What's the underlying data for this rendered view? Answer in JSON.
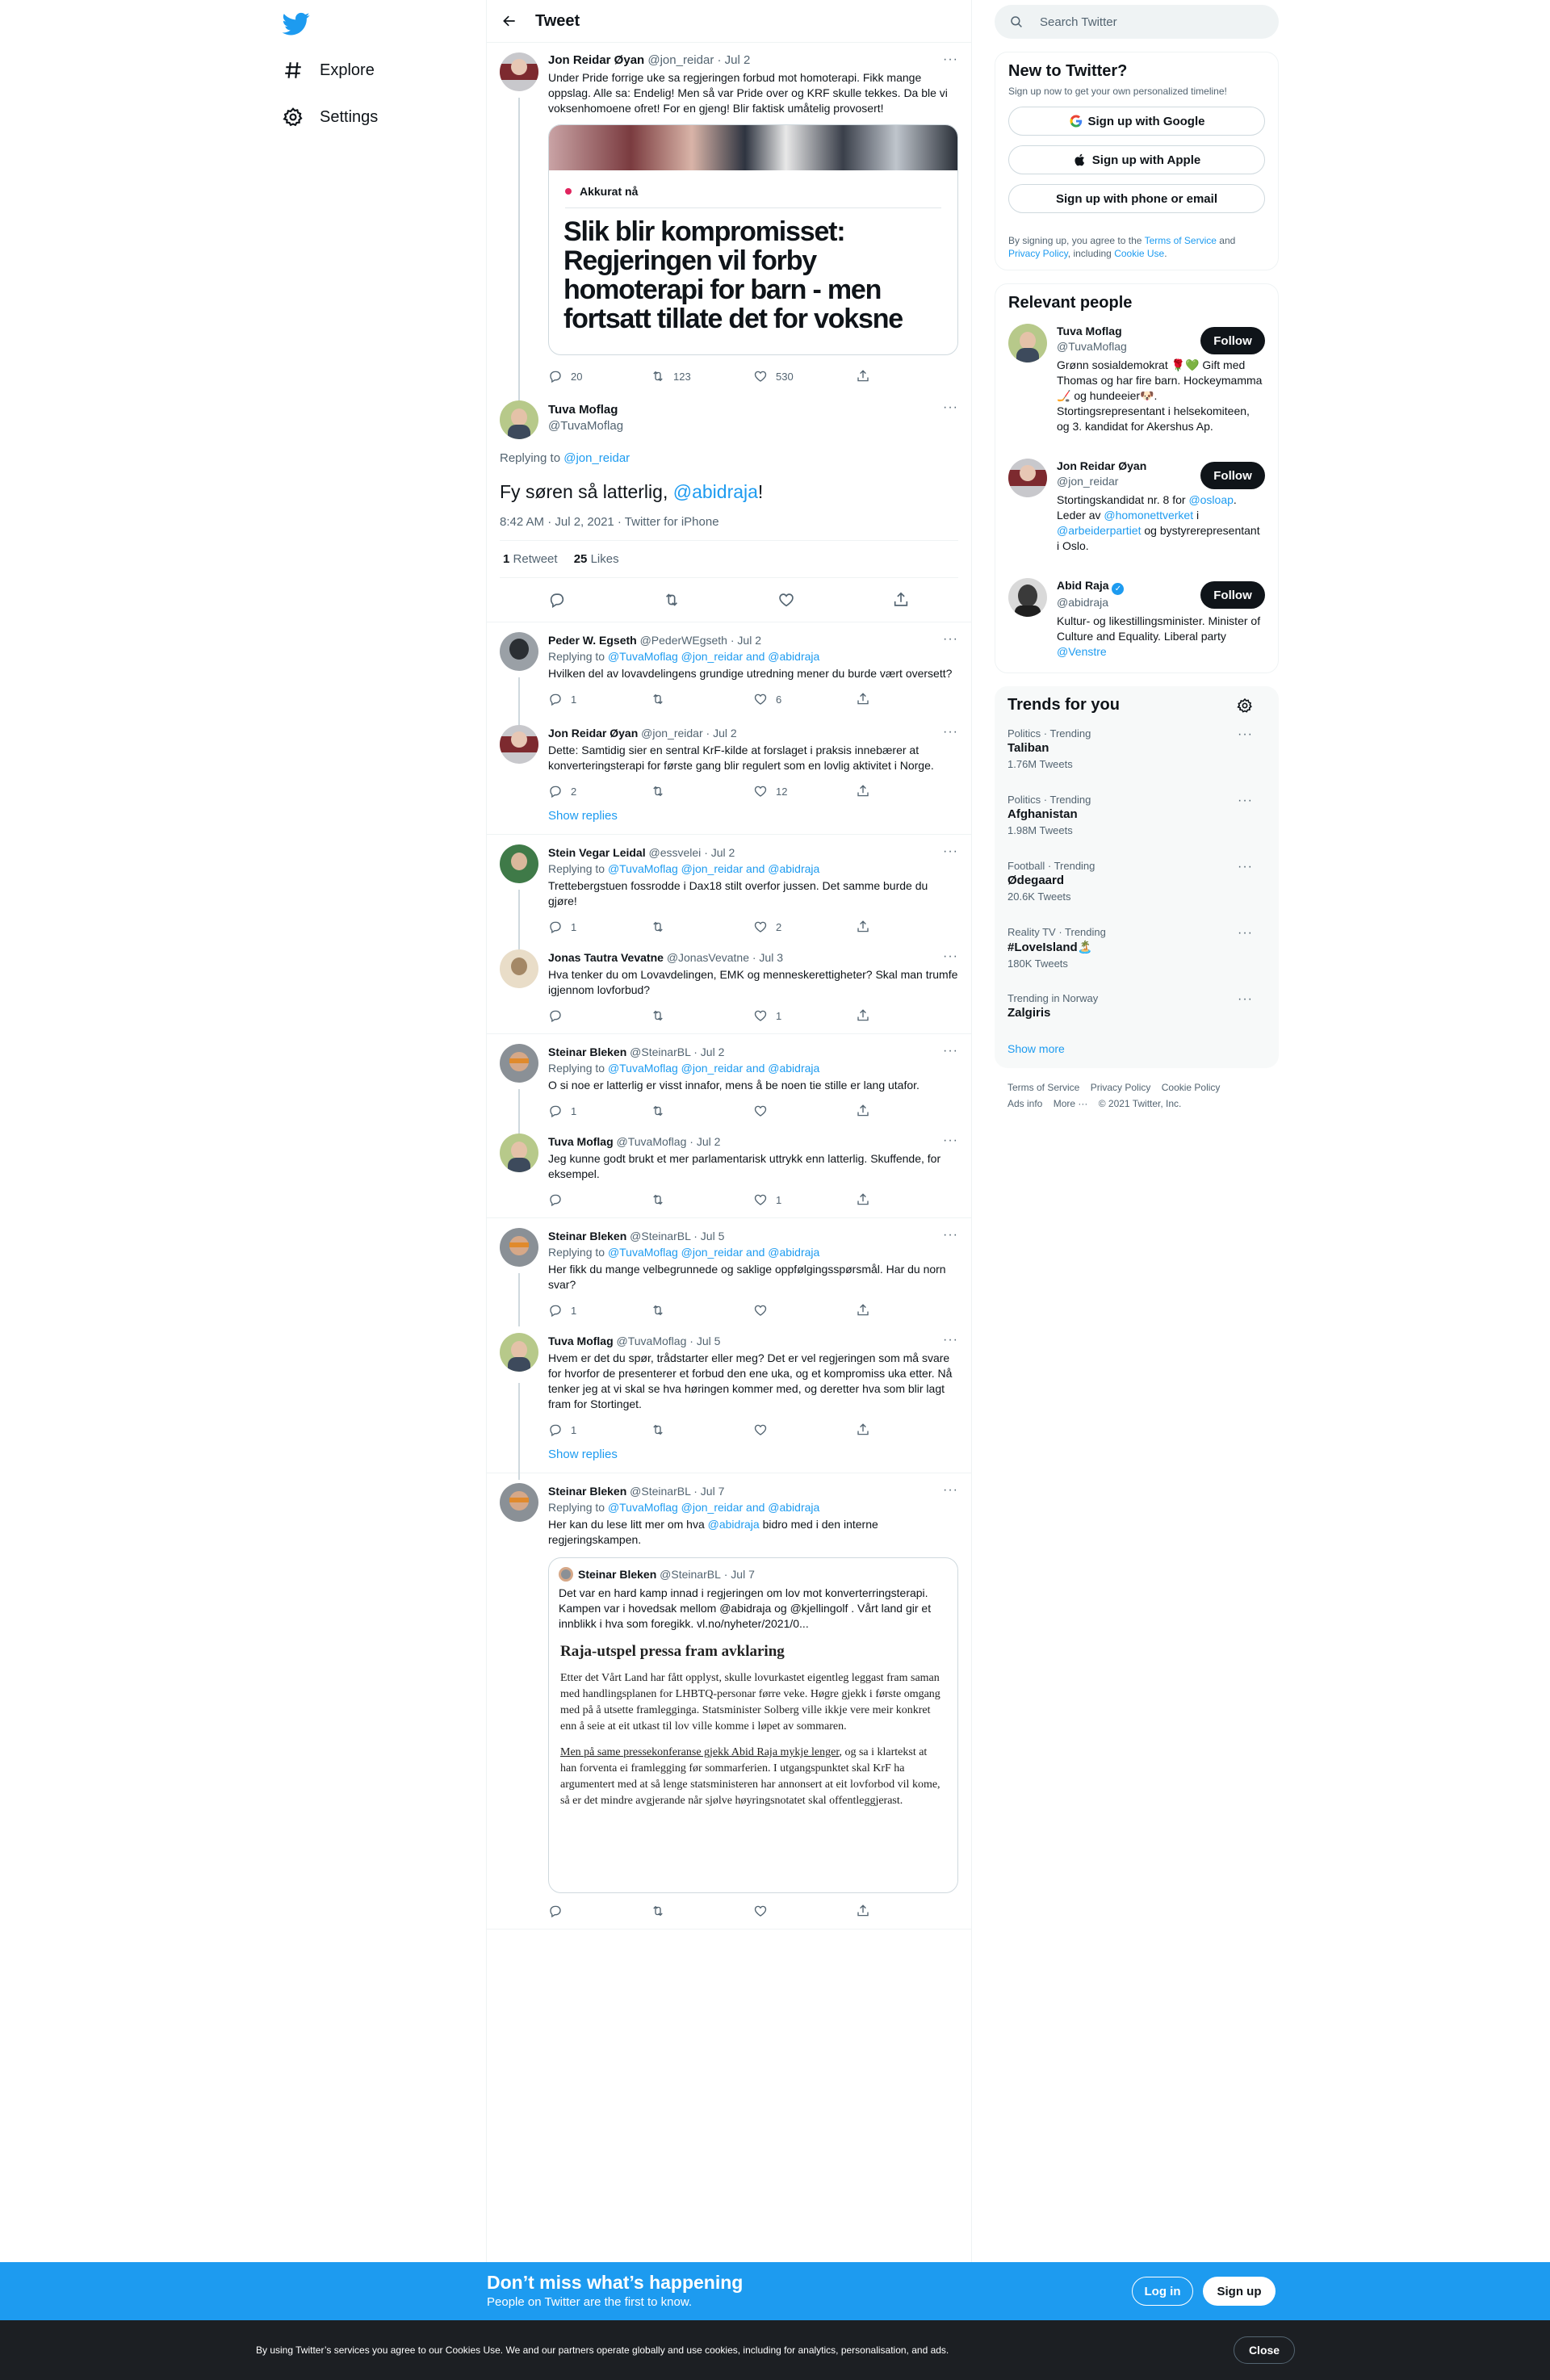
{
  "nav": {
    "explore": "Explore",
    "settings": "Settings"
  },
  "header": {
    "title": "Tweet"
  },
  "main_tweet_parent": {
    "name": "Jon Reidar Øyan",
    "handle": "@jon_reidar",
    "date": "· Jul 2",
    "text": "Under Pride forrige uke sa regjeringen forbud mot homoterapi. Fikk mange oppslag. Alle sa: Endelig! Men så var Pride over og KRF skulle tekkes. Da ble vi voksenhomoene ofret! For en gjeng! Blir faktisk umåtelig provosert!",
    "card_tag": "Akkurat nå",
    "card_title": "Slik blir kompromisset: Regjeringen vil forby homoterapi for barn - men fortsatt tillate det for voksne",
    "replies": "20",
    "retweets": "123",
    "likes": "530"
  },
  "focus_tweet": {
    "name": "Tuva Moflag",
    "handle": "@TuvaMoflag",
    "replying_label": "Replying to",
    "replying_to": "@jon_reidar",
    "text": "Fy søren så latterlig,",
    "mention": "@abidraja",
    "text_end": "!",
    "timestamp": "8:42 AM · Jul 2, 2021 · Twitter for iPhone",
    "retweets_count": "1",
    "retweets_label": "Retweet",
    "likes_count": "25",
    "likes_label": "Likes"
  },
  "replies": [
    {
      "name": "Peder W. Egseth",
      "handle": "@PederWEgseth",
      "date": "· Jul 2",
      "replying": "@TuvaMoflag @jon_reidar and @abidraja",
      "text": "Hvilken del av lovavdelingens grundige utredning mener du burde vært oversett?",
      "c": "1",
      "r": "",
      "l": "6"
    },
    {
      "name": "Jon Reidar Øyan",
      "handle": "@jon_reidar",
      "date": "· Jul 2",
      "replying": "",
      "text": "Dette: Samtidig sier en sentral KrF-kilde at forslaget i praksis innebærer at konverteringsterapi for første gang blir regulert som en lovlig aktivitet i Norge.",
      "c": "2",
      "r": "",
      "l": "12"
    },
    {
      "name": "Stein Vegar Leidal",
      "handle": "@essvelei",
      "date": "· Jul 2",
      "replying": "@TuvaMoflag @jon_reidar and @abidraja",
      "text": "Trettebergstuen fossrodde i Dax18 stilt overfor jussen. Det samme burde du gjøre!",
      "c": "1",
      "r": "",
      "l": "2"
    },
    {
      "name": "Jonas Tautra Vevatne",
      "handle": "@JonasVevatne",
      "date": "· Jul 3",
      "replying": "",
      "text": "Hva tenker du om Lovavdelingen, EMK og menneskerettigheter? Skal man trumfe igjennom lovforbud?",
      "c": "",
      "r": "",
      "l": "1"
    },
    {
      "name": "Steinar Bleken",
      "handle": "@SteinarBL",
      "date": "· Jul 2",
      "replying": "@TuvaMoflag @jon_reidar and @abidraja",
      "text": "O si noe er latterlig er visst innafor, mens å be noen tie stille er lang utafor.",
      "c": "1",
      "r": "",
      "l": ""
    },
    {
      "name": "Tuva Moflag",
      "handle": "@TuvaMoflag",
      "date": "· Jul 2",
      "replying": "",
      "text": "Jeg kunne godt brukt et mer parlamentarisk uttrykk enn latterlig. Skuffende, for eksempel.",
      "c": "",
      "r": "",
      "l": "1"
    },
    {
      "name": "Steinar Bleken",
      "handle": "@SteinarBL",
      "date": "· Jul 5",
      "replying": "@TuvaMoflag @jon_reidar and @abidraja",
      "text": "Her fikk du mange velbegrunnede og saklige oppfølgingsspørsmål. Har du norn svar?",
      "c": "1",
      "r": "",
      "l": ""
    },
    {
      "name": "Tuva Moflag",
      "handle": "@TuvaMoflag",
      "date": "· Jul 5",
      "replying": "",
      "text": "Hvem er det du spør, trådstarter eller meg? Det er vel regjeringen som må svare for hvorfor de presenterer et forbud den ene uka, og et kompromiss uka etter. Nå tenker jeg at vi skal se hva høringen kommer med, og deretter hva som blir lagt fram for Stortinget.",
      "c": "1",
      "r": "",
      "l": ""
    },
    {
      "name": "Steinar Bleken",
      "handle": "@SteinarBL",
      "date": "· Jul 7",
      "replying": "@TuvaMoflag @jon_reidar and @abidraja",
      "text": "Her kan du lese litt mer om hva",
      "mention": "@abidraja",
      "text_end": "bidro med i den interne regjeringskampen.",
      "c": "",
      "r": "",
      "l": ""
    }
  ],
  "show_replies": "Show replies",
  "quote": {
    "name": "Steinar Bleken",
    "handle": "@SteinarBL",
    "date": "· Jul 7",
    "text": "Det var en hard kamp innad i regjeringen om lov mot konverterringsterapi. Kampen var i hovedsak mellom @abidraja og @kjellingolf . Vårt land gir et innblikk i hva som foregikk. vl.no/nyheter/2021/0...",
    "article_title": "Raja-utspel pressa fram avklaring",
    "para1": "Etter det Vårt Land har fått opplyst, skulle lovurkastet eigentleg leggast fram saman med handlingsplanen for LHBTQ-personar førre veke. Høgre gjekk i første omgang med på å utsette framlegginga. Statsminister Solberg ville ikkje vere meir konkret enn å seie at eit utkast til lov ville komme i løpet av sommaren.",
    "para2_u": "Men på same pressekonferanse gjekk Abid Raja mykje lenger",
    "para2": ", og sa i klartekst at han forventa ei framlegging før sommarferien. I utgangspunktet skal KrF ha argumentert med at så lenge statsministeren har annonsert at eit lovforbod vil kome, så er det mindre avgjerande når sjølve høyringsnotatet skal offentleggjerast."
  },
  "right": {
    "search_placeholder": "Search Twitter",
    "new_title": "New to Twitter?",
    "new_sub": "Sign up now to get your own personalized timeline!",
    "btn_google": "Sign up with Google",
    "btn_apple": "Sign up with Apple",
    "btn_phone": "Sign up with phone or email",
    "terms_a": "By signing up, you agree to the",
    "terms_tos": "Terms of Service",
    "terms_and": "and",
    "terms_pp": "Privacy Policy",
    "terms_inc": ", including",
    "terms_cu": "Cookie Use",
    "relevant_title": "Relevant people",
    "follow_label": "Follow",
    "people": [
      {
        "name": "Tuva Moflag",
        "handle": "@TuvaMoflag",
        "bio": "Grønn sosialdemokrat 🌹💚 Gift med Thomas og har fire barn. Hockeymamma🏒 og hundeeier🐶. Stortingsrepresentant i helsekomiteen, og 3. kandidat for Akershus Ap."
      },
      {
        "name": "Jon Reidar Øyan",
        "handle": "@jon_reidar",
        "bio_a": "Stortingskandidat nr. 8 for",
        "bio_m1": "@osloap",
        "bio_b": ". Leder av",
        "bio_m2": "@homonettverket",
        "bio_c": "i",
        "bio_m3": "@arbeiderpartiet",
        "bio_d": "og bystyrerepresentant i Oslo."
      },
      {
        "name": "Abid Raja",
        "handle": "@abidraja",
        "bio_a": "Kultur- og likestillingsminister. Minister of Culture and Equality. Liberal party",
        "bio_m1": "@Venstre"
      }
    ],
    "trends_title": "Trends for you",
    "trends": [
      {
        "meta": "Politics · Trending",
        "name": "Taliban",
        "count": "1.76M Tweets"
      },
      {
        "meta": "Politics · Trending",
        "name": "Afghanistan",
        "count": "1.98M Tweets"
      },
      {
        "meta": "Football · Trending",
        "name": "Ødegaard",
        "count": "20.6K Tweets"
      },
      {
        "meta": "Reality TV · Trending",
        "name": "#LoveIsland🏝️",
        "count": "180K Tweets"
      },
      {
        "meta": "Trending in Norway",
        "name": "Zalgiris",
        "count": ""
      }
    ],
    "show_more": "Show more",
    "footer": [
      "Terms of Service",
      "Privacy Policy",
      "Cookie Policy",
      "Ads info",
      "More ···",
      "© 2021 Twitter, Inc."
    ]
  },
  "bottom": {
    "title": "Don’t miss what’s happening",
    "sub": "People on Twitter are the first to know.",
    "login": "Log in",
    "signup": "Sign up"
  },
  "cookie": {
    "text": "By using Twitter’s services you agree to our Cookies Use. We and our partners operate globally and use cookies, including for analytics, personalisation, and ads.",
    "close": "Close"
  },
  "colors": {
    "accent": "#1d9bf0",
    "text": "#0f1419",
    "muted": "#536471",
    "cookiebar": "#1c1f23",
    "live_dot": "#e0245e"
  }
}
